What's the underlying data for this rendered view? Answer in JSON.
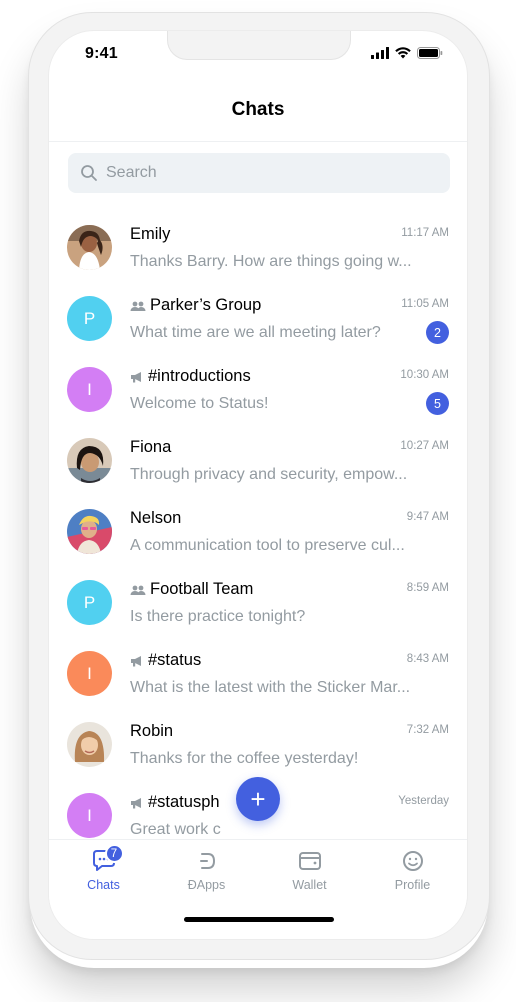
{
  "status_bar": {
    "time": "9:41"
  },
  "header": {
    "title": "Chats"
  },
  "search": {
    "placeholder": "Search"
  },
  "colors": {
    "accent": "#4360df",
    "muted": "#939ba1",
    "search_bg": "#eef2f5"
  },
  "chats": [
    {
      "name": "Emily",
      "type": "person",
      "time": "11:17 AM",
      "message": "Thanks Barry. How are things going w...",
      "avatar": "photo"
    },
    {
      "name": "Parker’s Group",
      "type": "group",
      "time": "11:05 AM",
      "message": "What time are we all meeting later?",
      "avatar_letter": "P",
      "avatar_color": "#51d0f0",
      "unread": "2"
    },
    {
      "name": "#introductions",
      "type": "channel",
      "time": "10:30 AM",
      "message": "Welcome to Status!",
      "avatar_letter": "I",
      "avatar_color": "#d37ef4",
      "unread": "5"
    },
    {
      "name": "Fiona",
      "type": "person",
      "time": "10:27 AM",
      "message": "Through privacy and security, empow...",
      "avatar": "photo"
    },
    {
      "name": "Nelson",
      "type": "person",
      "time": "9:47 AM",
      "message": "A communication tool to preserve cul...",
      "avatar": "photo"
    },
    {
      "name": "Football Team",
      "type": "group",
      "time": "8:59 AM",
      "message": "Is there practice tonight?",
      "avatar_letter": "P",
      "avatar_color": "#51d0f0"
    },
    {
      "name": "#status",
      "type": "channel",
      "time": "8:43 AM",
      "message": "What is the latest with the Sticker Mar...",
      "avatar_letter": "I",
      "avatar_color": "#fa8a5a"
    },
    {
      "name": "Robin",
      "type": "person",
      "time": "7:32 AM",
      "message": "Thanks for the coffee yesterday!",
      "avatar": "photo"
    },
    {
      "name": "#statusph",
      "type": "channel",
      "time": "Yesterday",
      "message": "Great work c",
      "avatar_letter": "I",
      "avatar_color": "#d37ef4"
    }
  ],
  "fab": {
    "label": "+"
  },
  "tabbar": {
    "tabs": [
      {
        "label": "Chats",
        "icon": "chat-icon",
        "badge": "7",
        "active": true
      },
      {
        "label": "ĐApps",
        "icon": "dapps-icon"
      },
      {
        "label": "Wallet",
        "icon": "wallet-icon"
      },
      {
        "label": "Profile",
        "icon": "profile-icon"
      }
    ]
  }
}
